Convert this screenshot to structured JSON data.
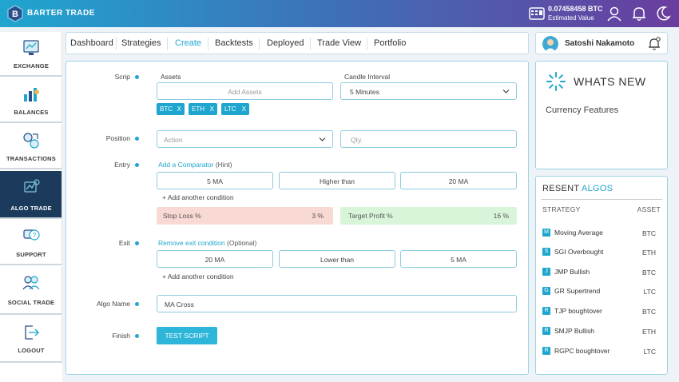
{
  "brand": {
    "name": "BARTER TRADE",
    "logo_letter": "B"
  },
  "header": {
    "btc_amount": "0.07458458 BTC",
    "estimated_label": "Estimated Value"
  },
  "sidebar": {
    "items": [
      {
        "label": "EXCHANGE"
      },
      {
        "label": "BALANCES"
      },
      {
        "label": "TRANSACTIONS"
      },
      {
        "label": "ALGO  TRADE"
      },
      {
        "label": "SUPPORT"
      },
      {
        "label": "SOCIAL TRADE"
      },
      {
        "label": "LOGOUT"
      }
    ]
  },
  "nav": {
    "tabs": [
      {
        "label": "Dashboard"
      },
      {
        "label": "Strategies"
      },
      {
        "label": "Create"
      },
      {
        "label": "Backtests"
      },
      {
        "label": "Deployed"
      },
      {
        "label": "Trade View"
      },
      {
        "label": "Portfolio"
      }
    ],
    "active": "Create"
  },
  "user": {
    "name": "Satoshi Nakamoto"
  },
  "form": {
    "scrip_label": "Scrip",
    "assets_label": "Assets",
    "assets_placeholder": "Add Assets",
    "candle_label": "Candle Interval",
    "candle_value": "5 Minutes",
    "chips": [
      {
        "label": "BTC",
        "x": "X"
      },
      {
        "label": "ETH",
        "x": "X"
      },
      {
        "label": "LTC",
        "x": "X"
      }
    ],
    "position_label": "Position",
    "action_placeholder": "Action",
    "qty_placeholder": "Qty.",
    "entry_label": "Entry",
    "add_comparator": "Add a Comparator",
    "hint": "(Hint)",
    "entry_conditions": [
      "5 MA",
      "Higher than",
      "20 MA"
    ],
    "add_condition": "+ Add another condition",
    "stop_loss_label": "Stop Loss  %",
    "stop_loss_value": "3 %",
    "target_label": "Target Profit  %",
    "target_value": "16 %",
    "exit_label": "Exit",
    "remove_exit": "Remove exit condition",
    "optional": "(Optional)",
    "exit_conditions": [
      "20 MA",
      "Lower than",
      "5 MA"
    ],
    "algo_name_label": "Algo Name",
    "algo_name_value": "MA Cross",
    "finish_label": "Finish",
    "test_button": "TEST SCRIPT"
  },
  "whats_new": {
    "title": "WHATS NEW",
    "subtitle": "Currency Features"
  },
  "algos": {
    "title_a": "RESENT ",
    "title_b": "ALGOS",
    "col_strategy": "STRATEGY",
    "col_asset": "ASSET",
    "rows": [
      {
        "badge": "M",
        "name": "Moving Average",
        "asset": "BTC"
      },
      {
        "badge": "S",
        "name": "SGI Overbought",
        "asset": "ETH"
      },
      {
        "badge": "J",
        "name": "JMP Bullish",
        "asset": "BTC"
      },
      {
        "badge": "G",
        "name": "GR Supertrend",
        "asset": "LTC"
      },
      {
        "badge": "R",
        "name": "TJP boughtover",
        "asset": "BTC"
      },
      {
        "badge": "R",
        "name": "SMJP Bullish",
        "asset": "ETH"
      },
      {
        "badge": "R",
        "name": "RGPC boughtover",
        "asset": "LTC"
      }
    ]
  },
  "colors": {
    "accent": "#1fa6cf",
    "sidebar_active": "#1b3a5c",
    "stop_loss_bg": "#f8d9d3",
    "target_bg": "#d8f5da"
  }
}
